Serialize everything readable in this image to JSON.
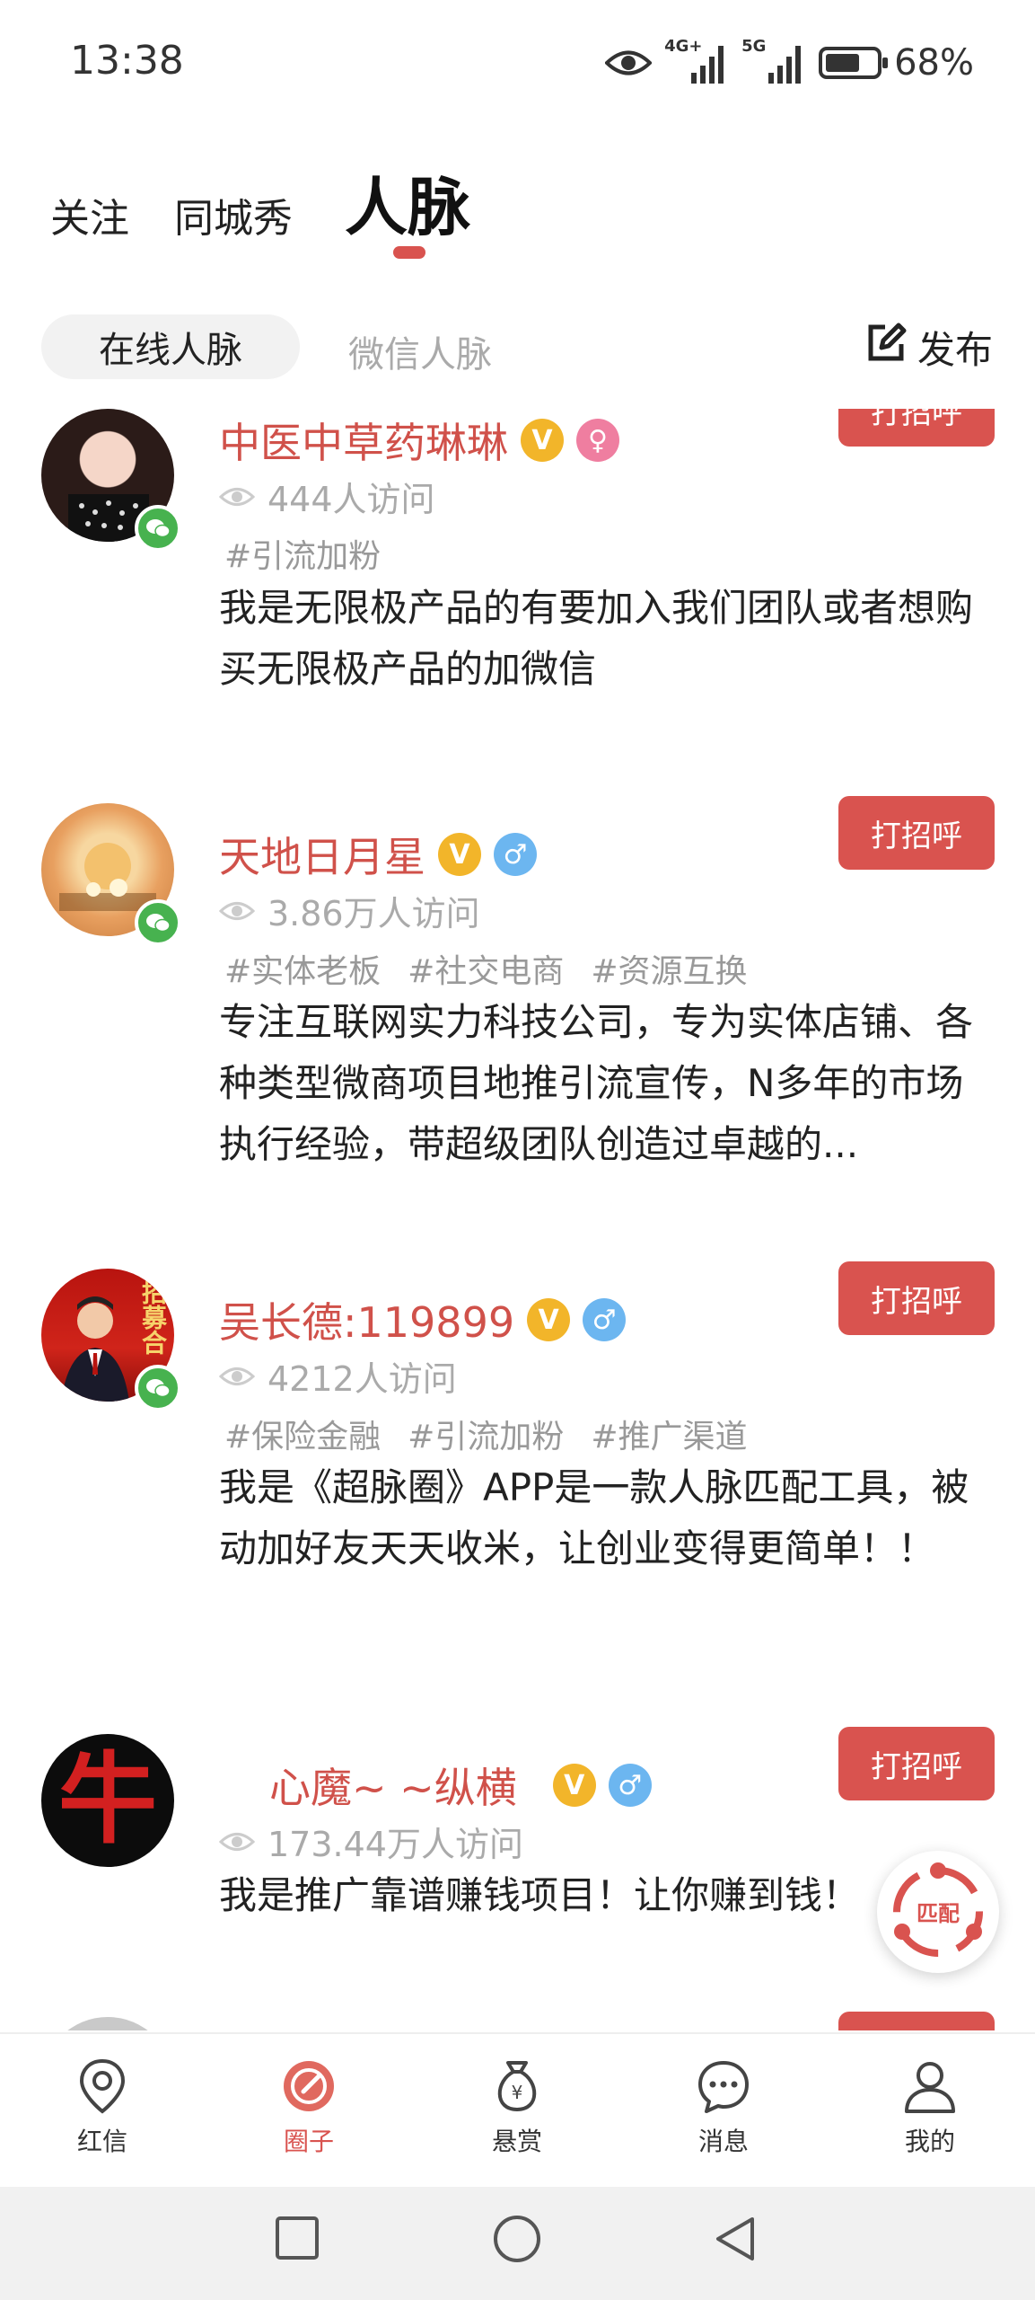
{
  "status_bar": {
    "time": "13:38",
    "network_1": "4G+",
    "network_2": "5G",
    "battery_percent": "68%",
    "battery_level": 0.68
  },
  "top_tabs": [
    {
      "label": "关注"
    },
    {
      "label": "同城秀"
    },
    {
      "label": "人脉",
      "active": true
    }
  ],
  "sub_tabs": {
    "online": "在线人脉",
    "wechat": "微信人脉",
    "publish": "发布"
  },
  "feed": [
    {
      "name": "中医中草药琳琳",
      "gender": "female",
      "gender_symbol": "♀",
      "verified": "V",
      "views": "444人访问",
      "tags": [
        "#引流加粉"
      ],
      "description": "我是无限极产品的有要加入我们团队或者想购买无限极产品的加微信",
      "greet": "打招呼"
    },
    {
      "name": "天地日月星",
      "gender": "male",
      "gender_symbol": "♂",
      "verified": "V",
      "views": "3.86万人访问",
      "tags": [
        "#实体老板",
        "#社交电商",
        "#资源互换"
      ],
      "description": "专注互联网实力科技公司，专为实体店铺、各种类型微商项目地推引流宣传，N多年的市场执行经验，带超级团队创造过卓越的...",
      "greet": "打招呼"
    },
    {
      "name": "吴长德:119899",
      "gender": "male",
      "gender_symbol": "♂",
      "verified": "V",
      "views": "4212人访问",
      "tags": [
        "#保险金融",
        "#引流加粉",
        "#推广渠道"
      ],
      "description": "我是《超脉圈》APP是一款人脉匹配工具，被动加好友天天收米，让创业变得更简单！！",
      "greet": "打招呼",
      "avatar_text": "招募合"
    },
    {
      "name": "心魔~ ~纵横",
      "gender": "male",
      "gender_symbol": "♂",
      "verified": "V",
      "views": "173.44万人访问",
      "tags": [],
      "description": "我是推广靠谱赚钱项目！让你赚到钱！",
      "greet": "打招呼",
      "avatar_text": "牛"
    }
  ],
  "match_fab": {
    "label": "匹配"
  },
  "bottom_nav": [
    {
      "label": "红信",
      "icon": "location-pin-icon"
    },
    {
      "label": "圈子",
      "icon": "circle-compass-icon",
      "active": true
    },
    {
      "label": "悬赏",
      "icon": "money-bag-icon"
    },
    {
      "label": "消息",
      "icon": "chat-bubble-icon"
    },
    {
      "label": "我的",
      "icon": "person-icon"
    }
  ],
  "colors": {
    "accent": "#d9534f",
    "name": "#d0514a",
    "wechat": "#47b24f",
    "verified": "#f2b52a",
    "male": "#6cb6f0",
    "female": "#ef7ea0"
  }
}
